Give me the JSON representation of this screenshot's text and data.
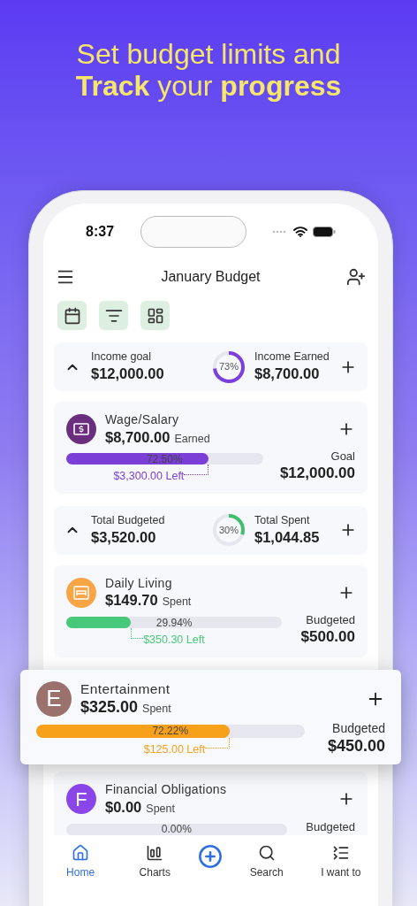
{
  "headline": {
    "line1": "Set budget limits and",
    "line2": "**Track** your **progress**"
  },
  "status_bar": {
    "time": "8:37"
  },
  "header": {
    "title": "January Budget"
  },
  "toolbar": [
    {
      "kind": "calendar"
    },
    {
      "kind": "filter"
    },
    {
      "kind": "layout"
    }
  ],
  "sections": [
    {
      "summary": {
        "expanded": true,
        "left_label": "Income goal",
        "left_value": "$12,000.00",
        "ring_text": "73%",
        "level": 0.73,
        "color": "#7b3fe0",
        "right_label": "Income Earned",
        "right_value": "$8,700.00"
      },
      "items": [
        {
          "name": "Wage/Salary",
          "amount": "$8,700.00",
          "amount_label": "Earned",
          "avatar": {
            "kind": "money",
            "color": "#6b2e7e"
          },
          "color": "#7b3fd8",
          "level": 0.725,
          "percent": "72.50%",
          "left": "$3,300.00 Left",
          "target_label": "Goal",
          "target": "$12,000.00",
          "raised": false
        }
      ]
    },
    {
      "summary": {
        "expanded": true,
        "left_label": "Total Budgeted",
        "left_value": "$3,520.00",
        "ring_text": "30%",
        "level": 0.3,
        "color": "#3fbf6a",
        "right_label": "Total Spent",
        "right_value": "$1,044.85"
      },
      "items": [
        {
          "name": "Daily Living",
          "amount": "$149.70",
          "amount_label": "Spent",
          "avatar": {
            "kind": "bed",
            "color": "#f9a545"
          },
          "color": "#48c87a",
          "level": 0.2994,
          "percent": "29.94%",
          "left": "$350.30 Left",
          "target_label": "Budgeted",
          "target": "$500.00",
          "raised": false
        },
        {
          "name": "Entertainment",
          "amount": "$325.00",
          "amount_label": "Spent",
          "avatar": {
            "kind": "letter",
            "letter": "E",
            "color": "#9a716d"
          },
          "color": "#f7a11a",
          "level": 0.7222,
          "percent": "72.22%",
          "left": "$125.00 Left",
          "target_label": "Budgeted",
          "target": "$450.00",
          "raised": true
        },
        {
          "name": "Financial Obligations",
          "amount": "$0.00",
          "amount_label": "Spent",
          "avatar": {
            "kind": "letter",
            "letter": "F",
            "color": "#8b46ea"
          },
          "level": 0,
          "percent": "0.00%",
          "target_label": "Budgeted",
          "raised": false
        }
      ]
    }
  ],
  "nav": [
    {
      "kind": "home",
      "label": "Home",
      "selected": true
    },
    {
      "kind": "charts",
      "label": "Charts",
      "selected": false
    },
    {
      "kind": "add",
      "selected": false
    },
    {
      "kind": "search",
      "label": "Search",
      "selected": false
    },
    {
      "kind": "menu",
      "label": "I want to",
      "selected": false
    }
  ]
}
